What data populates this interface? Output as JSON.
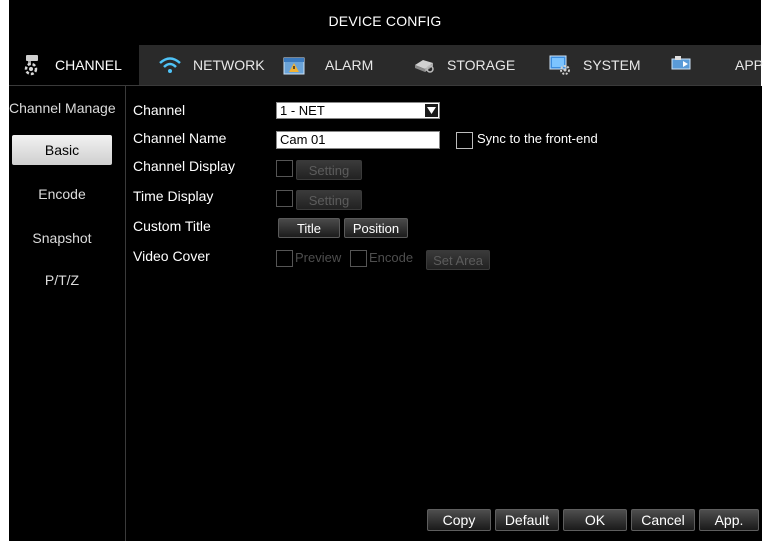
{
  "window": {
    "title": "DEVICE CONFIG"
  },
  "tabs": [
    {
      "label": "CHANNEL",
      "icon": "camera-icon",
      "active": true
    },
    {
      "label": "NETWORK",
      "icon": "wifi-icon",
      "active": false
    },
    {
      "label": "ALARM",
      "icon": "alarm-icon",
      "active": false
    },
    {
      "label": "STORAGE",
      "icon": "storage-icon",
      "active": false
    },
    {
      "label": "SYSTEM",
      "icon": "system-icon",
      "active": false
    },
    {
      "label": "APP",
      "icon": "app-icon",
      "active": false
    }
  ],
  "sidebar": {
    "header": "Channel Manage",
    "items": [
      {
        "label": "Basic",
        "active": true
      },
      {
        "label": "Encode",
        "active": false
      },
      {
        "label": "Snapshot",
        "active": false
      },
      {
        "label": "P/T/Z",
        "active": false
      }
    ]
  },
  "form": {
    "channel": {
      "label": "Channel",
      "value": "1 - NET"
    },
    "channel_name": {
      "label": "Channel Name",
      "value": "Cam 01",
      "sync_label": "Sync to the front-end"
    },
    "channel_display": {
      "label": "Channel Display",
      "setting_label": "Setting"
    },
    "time_display": {
      "label": "Time Display",
      "setting_label": "Setting"
    },
    "custom_title": {
      "label": "Custom Title",
      "title_button": "Title",
      "position_button": "Position"
    },
    "video_cover": {
      "label": "Video Cover",
      "preview_label": "Preview",
      "encode_label": "Encode",
      "set_area_button": "Set Area"
    }
  },
  "footer": {
    "copy": "Copy",
    "default": "Default",
    "ok": "OK",
    "cancel": "Cancel",
    "apply": "App."
  },
  "colors": {
    "background": "#000000",
    "tabbar": "#2a2a2a",
    "active_sidebar": "#e6e6e6",
    "wifi_accent": "#4fc3f7"
  }
}
